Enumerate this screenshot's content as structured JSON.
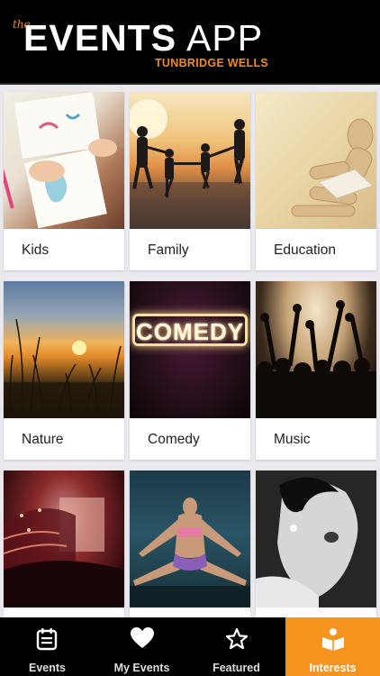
{
  "header": {
    "logo_the": "the",
    "logo_events": "EVENTS",
    "logo_app": "APP",
    "subtitle": "TUNBRIDGE WELLS",
    "accent_color": "#f28a1e"
  },
  "categories": [
    {
      "label": "Kids",
      "image": "kids-drawing-image"
    },
    {
      "label": "Family",
      "image": "family-beach-sunset-image"
    },
    {
      "label": "Education",
      "image": "wooden-mannequin-reading-image"
    },
    {
      "label": "Nature",
      "image": "sunset-grass-field-image"
    },
    {
      "label": "Comedy",
      "image": "comedy-neon-sign-image",
      "sign_text": "COMEDY"
    },
    {
      "label": "Music",
      "image": "concert-crowd-image"
    },
    {
      "label": "",
      "image": "theatre-auditorium-image"
    },
    {
      "label": "",
      "image": "dancer-split-image"
    },
    {
      "label": "",
      "image": "singer-portrait-image"
    }
  ],
  "tabs": [
    {
      "label": "Events",
      "icon": "calendar-list-icon",
      "active": false
    },
    {
      "label": "My Events",
      "icon": "heart-icon",
      "active": false
    },
    {
      "label": "Featured",
      "icon": "star-icon",
      "active": false
    },
    {
      "label": "Interests",
      "icon": "reader-icon",
      "active": true
    }
  ],
  "colors": {
    "tab_active": "#f7941d",
    "tabbar_bg": "#000000",
    "background": "#e9e9ee"
  }
}
